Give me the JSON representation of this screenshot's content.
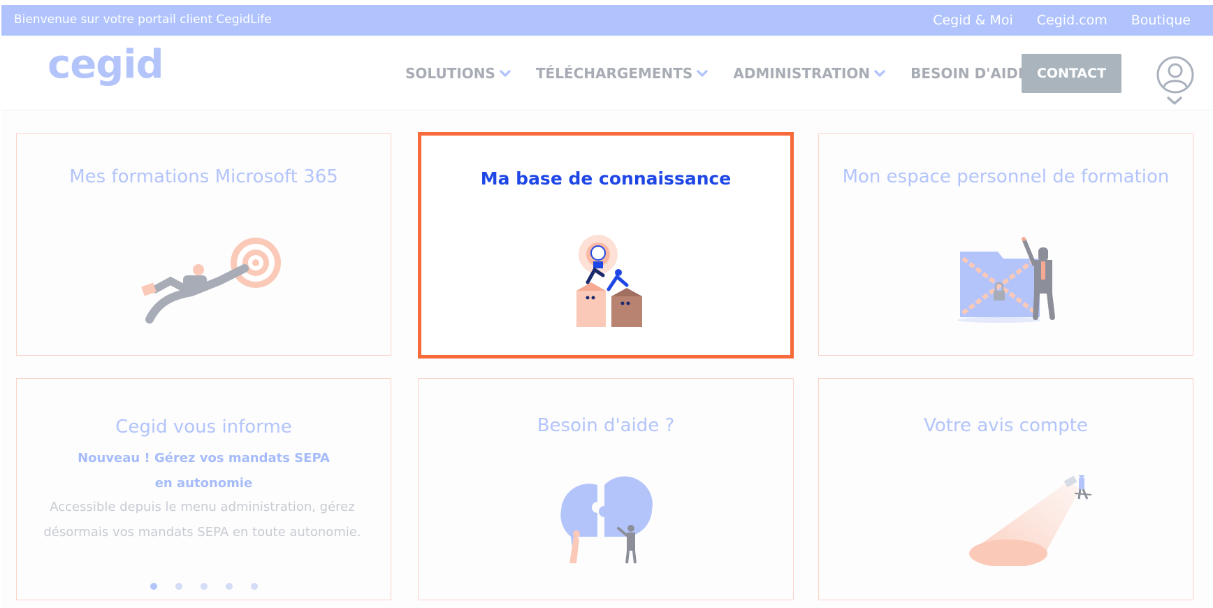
{
  "topbar": {
    "welcome": "Bienvenue sur votre portail client CegidLife",
    "links": [
      "Cegid & Moi",
      "Cegid.com",
      "Boutique"
    ]
  },
  "header": {
    "logo": "cegid",
    "nav": [
      {
        "label": "SOLUTIONS"
      },
      {
        "label": "TÉLÉCHARGEMENTS"
      },
      {
        "label": "ADMINISTRATION"
      },
      {
        "label": "BESOIN D'AIDE"
      }
    ],
    "contact": "CONTACT"
  },
  "cards": {
    "microsoft": {
      "title": "Mes formations Microsoft 365",
      "icon": "target-kick-illustration"
    },
    "knowledge": {
      "title": "Ma base de connaissance",
      "icon": "lightbulb-idea-illustration"
    },
    "personal_training": {
      "title": "Mon espace personnel de formation",
      "icon": "locked-folder-illustration"
    },
    "news": {
      "title": "Cegid vous informe",
      "subtitle": "Nouveau ! Gérez vos mandats SEPA en autonomie",
      "body": "Accessible depuis le menu administration, gérez désormais vos mandats SEPA en toute autonomie.",
      "slide_count": 5,
      "active_slide": 1
    },
    "help": {
      "title": "Besoin d'aide ?",
      "icon": "puzzle-chat-illustration"
    },
    "feedback": {
      "title": "Votre avis compte",
      "icon": "spotlight-illustration"
    }
  },
  "colors": {
    "topbar": "#b0c3fd",
    "brand_light": "#b3c4fb",
    "active_border": "#f96a3a",
    "active_title": "#1f47e5",
    "card_border": "#fbd2c8",
    "contact_button": "#a9b4bd"
  }
}
